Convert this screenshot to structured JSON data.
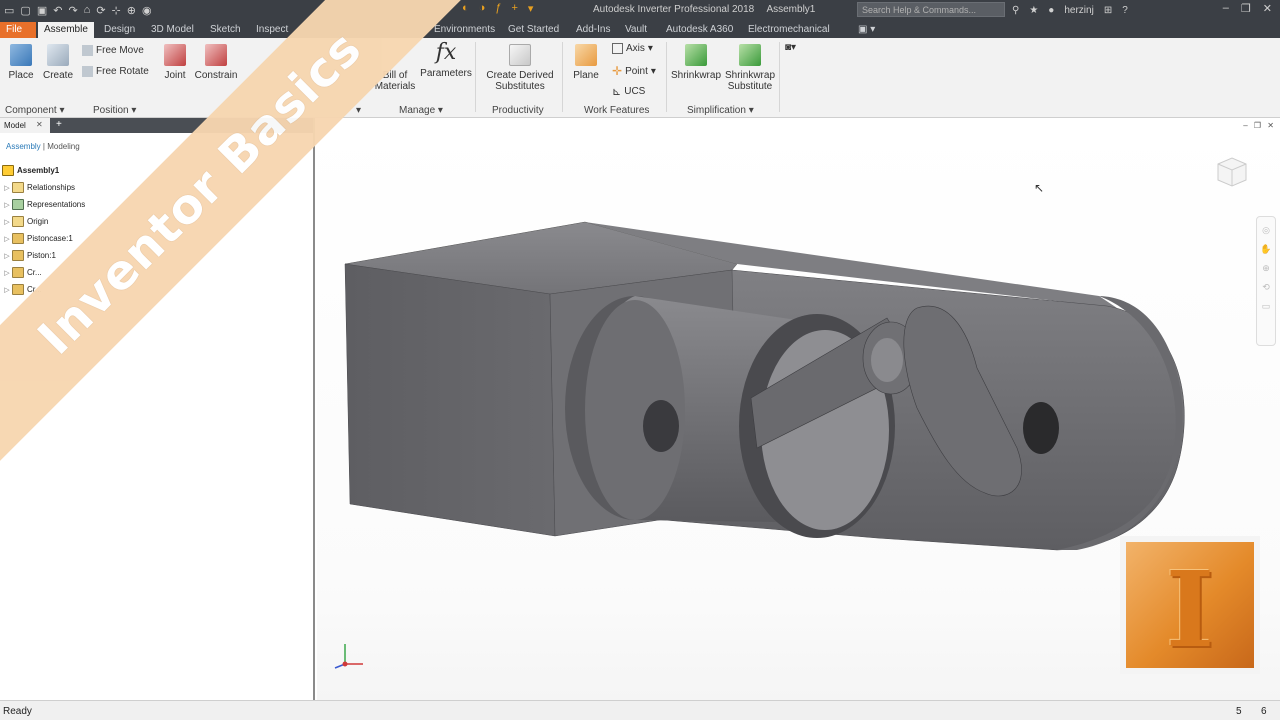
{
  "titlebar": {
    "app_title": "Autodesk Inverter Professional 2018",
    "document": "Assembly1",
    "search_placeholder": "Search Help & Commands...",
    "user": "herzinj"
  },
  "tabs": [
    "File",
    "Assemble",
    "Design",
    "3D Model",
    "Sketch",
    "Inspect",
    "Environments",
    "Get Started",
    "Add-Ins",
    "Vault",
    "Autodesk A360",
    "Electromechanical"
  ],
  "ribbon": {
    "place": "Place",
    "create": "Create",
    "free_move": "Free Move",
    "free_rotate": "Free Rotate",
    "joint": "Joint",
    "constrain": "Constrain",
    "bill_of_materials": "Bill of\nMaterials",
    "parameters": "Parameters",
    "create_derived": "Create Derived\nSubstitutes",
    "plane": "Plane",
    "axis": "Axis",
    "point": "Point",
    "ucs": "UCS",
    "shrinkwrap": "Shrinkwrap",
    "shrinkwrap_substitute": "Shrinkwrap\nSubstitute",
    "panels": {
      "component": "Component",
      "position": "Position",
      "manage": "Manage",
      "productivity": "Productivity",
      "work_features": "Work Features",
      "simplification": "Simplification"
    }
  },
  "browser": {
    "tab": "Model",
    "subtab_active": "Assembly",
    "subtab_other": "Modeling",
    "tree": [
      {
        "label": "Assembly1",
        "root": true
      },
      {
        "label": "Relationships"
      },
      {
        "label": "Representations"
      },
      {
        "label": "Origin"
      },
      {
        "label": "Pistoncase:1"
      },
      {
        "label": "Piston:1"
      },
      {
        "label": "Cr..."
      },
      {
        "label": "Cr..."
      }
    ]
  },
  "banner_text": "Inventor Basics",
  "logo_letter": "I",
  "status": {
    "text": "Ready",
    "num1": "5",
    "num2": "6"
  },
  "colors": {
    "accent_file": "#e8702a",
    "model_gray": "#6e6e72",
    "banner": "#f7d6b0"
  }
}
